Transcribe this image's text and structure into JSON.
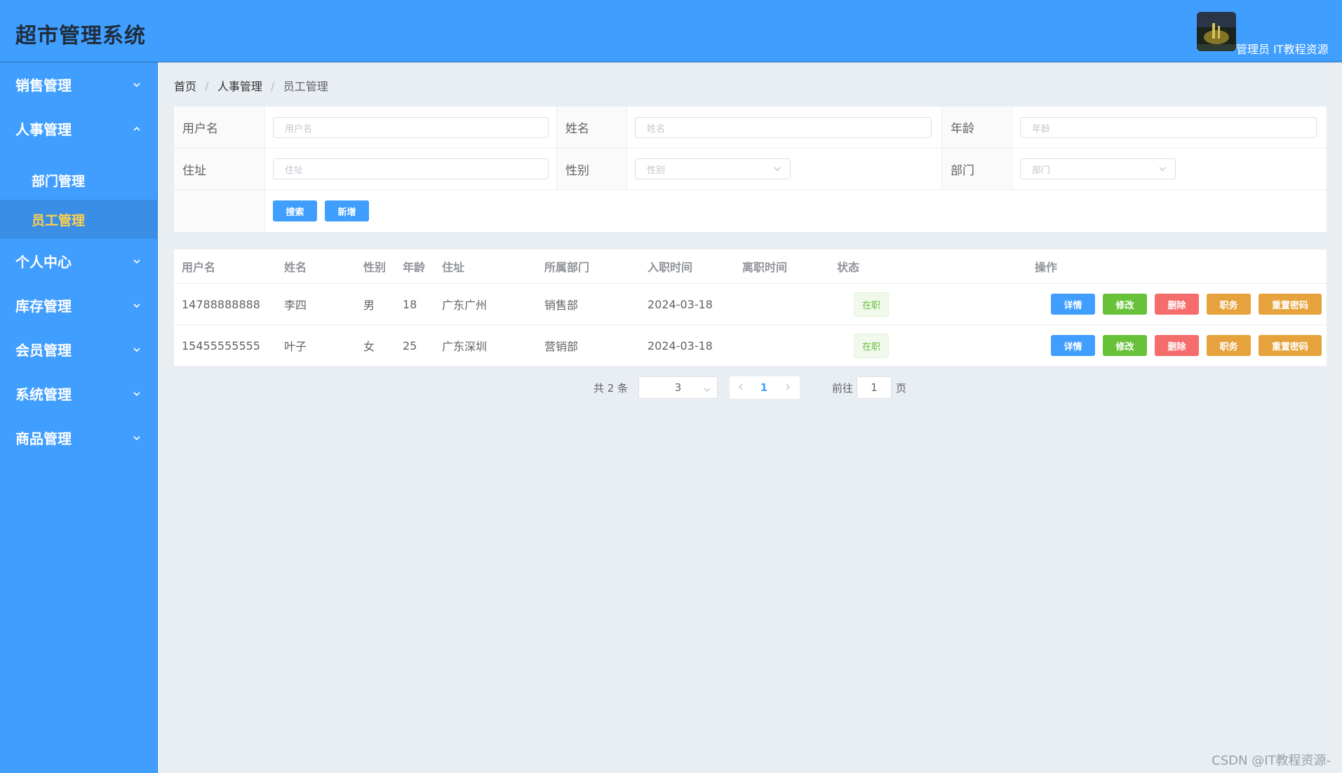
{
  "header": {
    "app_title": "超市管理系统",
    "user_label": "管理员 IT教程资源"
  },
  "sidebar": {
    "items": [
      {
        "label": "销售管理",
        "expanded": false
      },
      {
        "label": "人事管理",
        "expanded": true,
        "children": [
          {
            "label": "部门管理",
            "active": false
          },
          {
            "label": "员工管理",
            "active": true
          }
        ]
      },
      {
        "label": "个人中心",
        "expanded": false
      },
      {
        "label": "库存管理",
        "expanded": false
      },
      {
        "label": "会员管理",
        "expanded": false
      },
      {
        "label": "系统管理",
        "expanded": false
      },
      {
        "label": "商品管理",
        "expanded": false
      }
    ]
  },
  "breadcrumb": {
    "items": [
      "首页",
      "人事管理",
      "员工管理"
    ],
    "separator": "/"
  },
  "search": {
    "username": {
      "label": "用户名",
      "placeholder": "用户名"
    },
    "name": {
      "label": "姓名",
      "placeholder": "姓名"
    },
    "age": {
      "label": "年龄",
      "placeholder": "年龄"
    },
    "address": {
      "label": "住址",
      "placeholder": "住址"
    },
    "gender": {
      "label": "性别",
      "placeholder": "性别"
    },
    "department": {
      "label": "部门",
      "placeholder": "部门"
    },
    "search_button": "搜索",
    "add_button": "新增"
  },
  "table": {
    "columns": [
      "用户名",
      "姓名",
      "性别",
      "年龄",
      "住址",
      "所属部门",
      "入职时间",
      "离职时间",
      "状态",
      "操作"
    ],
    "rows": [
      {
        "username": "14788888888",
        "name": "李四",
        "gender": "男",
        "age": "18",
        "address": "广东广州",
        "department": "销售部",
        "hire_date": "2024-03-18",
        "leave_date": "",
        "status": "在职"
      },
      {
        "username": "15455555555",
        "name": "叶子",
        "gender": "女",
        "age": "25",
        "address": "广东深圳",
        "department": "营销部",
        "hire_date": "2024-03-18",
        "leave_date": "",
        "status": "在职"
      }
    ],
    "actions": {
      "detail": "详情",
      "edit": "修改",
      "delete": "删除",
      "position": "职务",
      "reset_password": "重置密码"
    }
  },
  "pagination": {
    "total_text": "共 2 条",
    "page_size": "3",
    "current_page": "1",
    "goto_prefix": "前往",
    "goto_value": "1",
    "goto_suffix": "页"
  },
  "watermark": "CSDN @IT教程资源-",
  "colors": {
    "primary": "#409eff",
    "success": "#67c23a",
    "danger": "#f56c6c",
    "warning": "#e6a23c",
    "active_menu_text": "#ffd04b"
  }
}
